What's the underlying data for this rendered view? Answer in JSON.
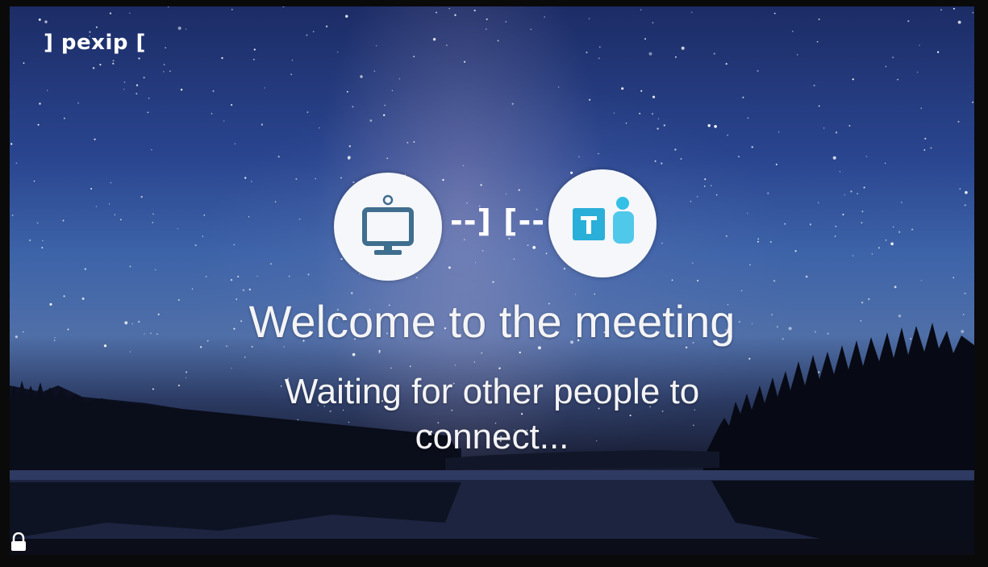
{
  "brand": {
    "logo_text": "] pexip ["
  },
  "connection": {
    "left_icon": "video-endpoint-icon",
    "right_icon": "teams-icon",
    "connector_text": "--] [--",
    "colors": {
      "endpoint": "#3f6e8e",
      "teams_accent": "#33c0e6",
      "teams_dark": "#1a8fc0",
      "circle_bg": "#f5f7fa"
    }
  },
  "messages": {
    "welcome": "Welcome to the meeting",
    "waiting": "Waiting for other people to connect..."
  },
  "status": {
    "lock_icon": "lock-icon"
  }
}
